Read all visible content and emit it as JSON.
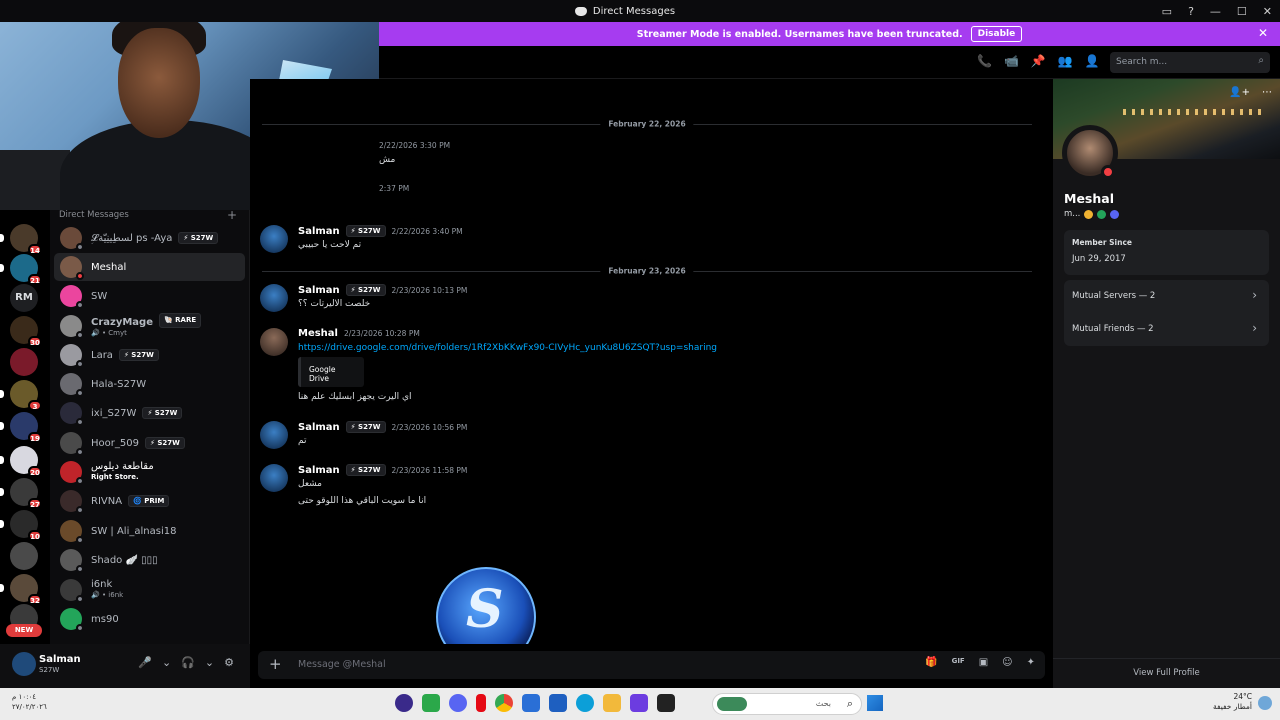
{
  "window": {
    "title": "Direct Messages",
    "controls": [
      "▭",
      "?",
      "—",
      "☐",
      "✕"
    ]
  },
  "streamer_bar": {
    "text": "Streamer Mode is enabled. Usernames have been truncated.",
    "button": "Disable",
    "close": "✕"
  },
  "servers": [
    {
      "badge": "14"
    },
    {
      "badge": "21"
    },
    {
      "label": "RM"
    },
    {
      "badge": "30"
    },
    {
      "badge": ""
    },
    {
      "badge": "3"
    },
    {
      "badge": "19"
    },
    {
      "badge": "20"
    },
    {
      "badge": "27"
    },
    {
      "badge": "10"
    },
    {
      "badge": ""
    },
    {
      "badge": "32"
    },
    {
      "badge": ""
    }
  ],
  "servers_new": "NEW",
  "dm_list": {
    "header": "Direct Messages",
    "plus": "+",
    "items": [
      {
        "name": "𝓛ِلسطِينِيّة ps -Aya",
        "tag": "⚡ S27W"
      },
      {
        "name": "Meshal"
      },
      {
        "name": "SW"
      },
      {
        "name": "CrazyMage",
        "tag": "🐚 RARE",
        "sub": "🔊 • Cmyt"
      },
      {
        "name": "Lara",
        "tag": "⚡ S27W"
      },
      {
        "name": "Hala-S27W"
      },
      {
        "name": "ixi_S27W",
        "tag": "⚡ S27W"
      },
      {
        "name": "Hoor_509",
        "tag": "⚡ S27W"
      },
      {
        "name": "مقاطعة ديلوس",
        "sub": "Right Store."
      },
      {
        "name": "RIVNA",
        "tag": "🌀 PRIM"
      },
      {
        "name": "SW | Ali_alnasi18"
      },
      {
        "name": "Shado 🪽 ▯▯▯"
      },
      {
        "name": "i6nk",
        "sub": "🔊 • i6nk"
      },
      {
        "name": "ms90"
      }
    ]
  },
  "user_panel": {
    "name": "Salman",
    "sub": "S27W",
    "icons": [
      "🎤",
      "⌄",
      "🎧",
      "⌄",
      "⚙"
    ]
  },
  "chat": {
    "header_icons": [
      "📞",
      "📹",
      "📌",
      "👥",
      "👤"
    ],
    "search_placeholder": "Search m...",
    "search_icon": "⌕",
    "dividers": [
      "February 22, 2026",
      "February 23, 2026"
    ],
    "partial_timestamps": [
      "2/22/2026 3:30 PM",
      "2:37 PM"
    ],
    "partial_text": "مش",
    "messages": [
      {
        "author": "Salman",
        "tag": "⚡ S27W",
        "time": "2/22/2026 3:40 PM",
        "lines": [
          "تم لاحت يا حبيبي"
        ]
      },
      {
        "author": "Salman",
        "tag": "⚡ S27W",
        "time": "2/23/2026 10:13 PM",
        "lines": [
          "خلصت الاليرتات ؟؟"
        ]
      },
      {
        "author": "Meshal",
        "time": "2/23/2026 10:28 PM",
        "link": "https://drive.google.com/drive/folders/1Rf2XbKKwFx90-CIVyHc_yunKu8U6ZSQT?usp=sharing",
        "embed": "Google Drive",
        "lines": [
          "اي اليرت يجهز ابسليك علم هنا"
        ]
      },
      {
        "author": "Salman",
        "tag": "⚡ S27W",
        "time": "2/23/2026 10:56 PM",
        "lines": [
          "تم"
        ]
      },
      {
        "author": "Salman",
        "tag": "⚡ S27W",
        "time": "2/23/2026 11:58 PM",
        "lines": [
          "مشعل",
          "انا ما سويت الباقي هذا اللوقو حتى"
        ]
      }
    ],
    "composer_placeholder": "Message @Meshal",
    "composer_plus": "+",
    "composer_tools": [
      "🎁",
      "GIF",
      "▣",
      "☺",
      "✦"
    ]
  },
  "profile": {
    "top_icons": [
      "👤+",
      "⋯"
    ],
    "name": "Meshal",
    "username": "m...",
    "member_since_label": "Member Since",
    "member_since": "Jun 29, 2017",
    "mutual_servers": "Mutual Servers — 2",
    "mutual_friends": "Mutual Friends — 2",
    "chevron": "›",
    "view_full": "View Full Profile",
    "badge_colors": [
      "#f0b232",
      "#23a55a",
      "#5865f2"
    ]
  },
  "taskbar": {
    "left_line1": "١٠:٠٤ م",
    "left_line2": "٢٧/٠٢/٢٠٢٦",
    "search_text": "بحث",
    "search_icon": "⌕",
    "temp": "24°C",
    "weather": "أمطار خفيفة",
    "app_colors": [
      "#3a2a8a",
      "#2ba84a",
      "#5865f2",
      "#e50914",
      "#ea4335",
      "#2a6fd6",
      "#1e5fc0",
      "#0c9fd8",
      "#f2b93b",
      "#6c3ce0",
      "#222222"
    ]
  }
}
